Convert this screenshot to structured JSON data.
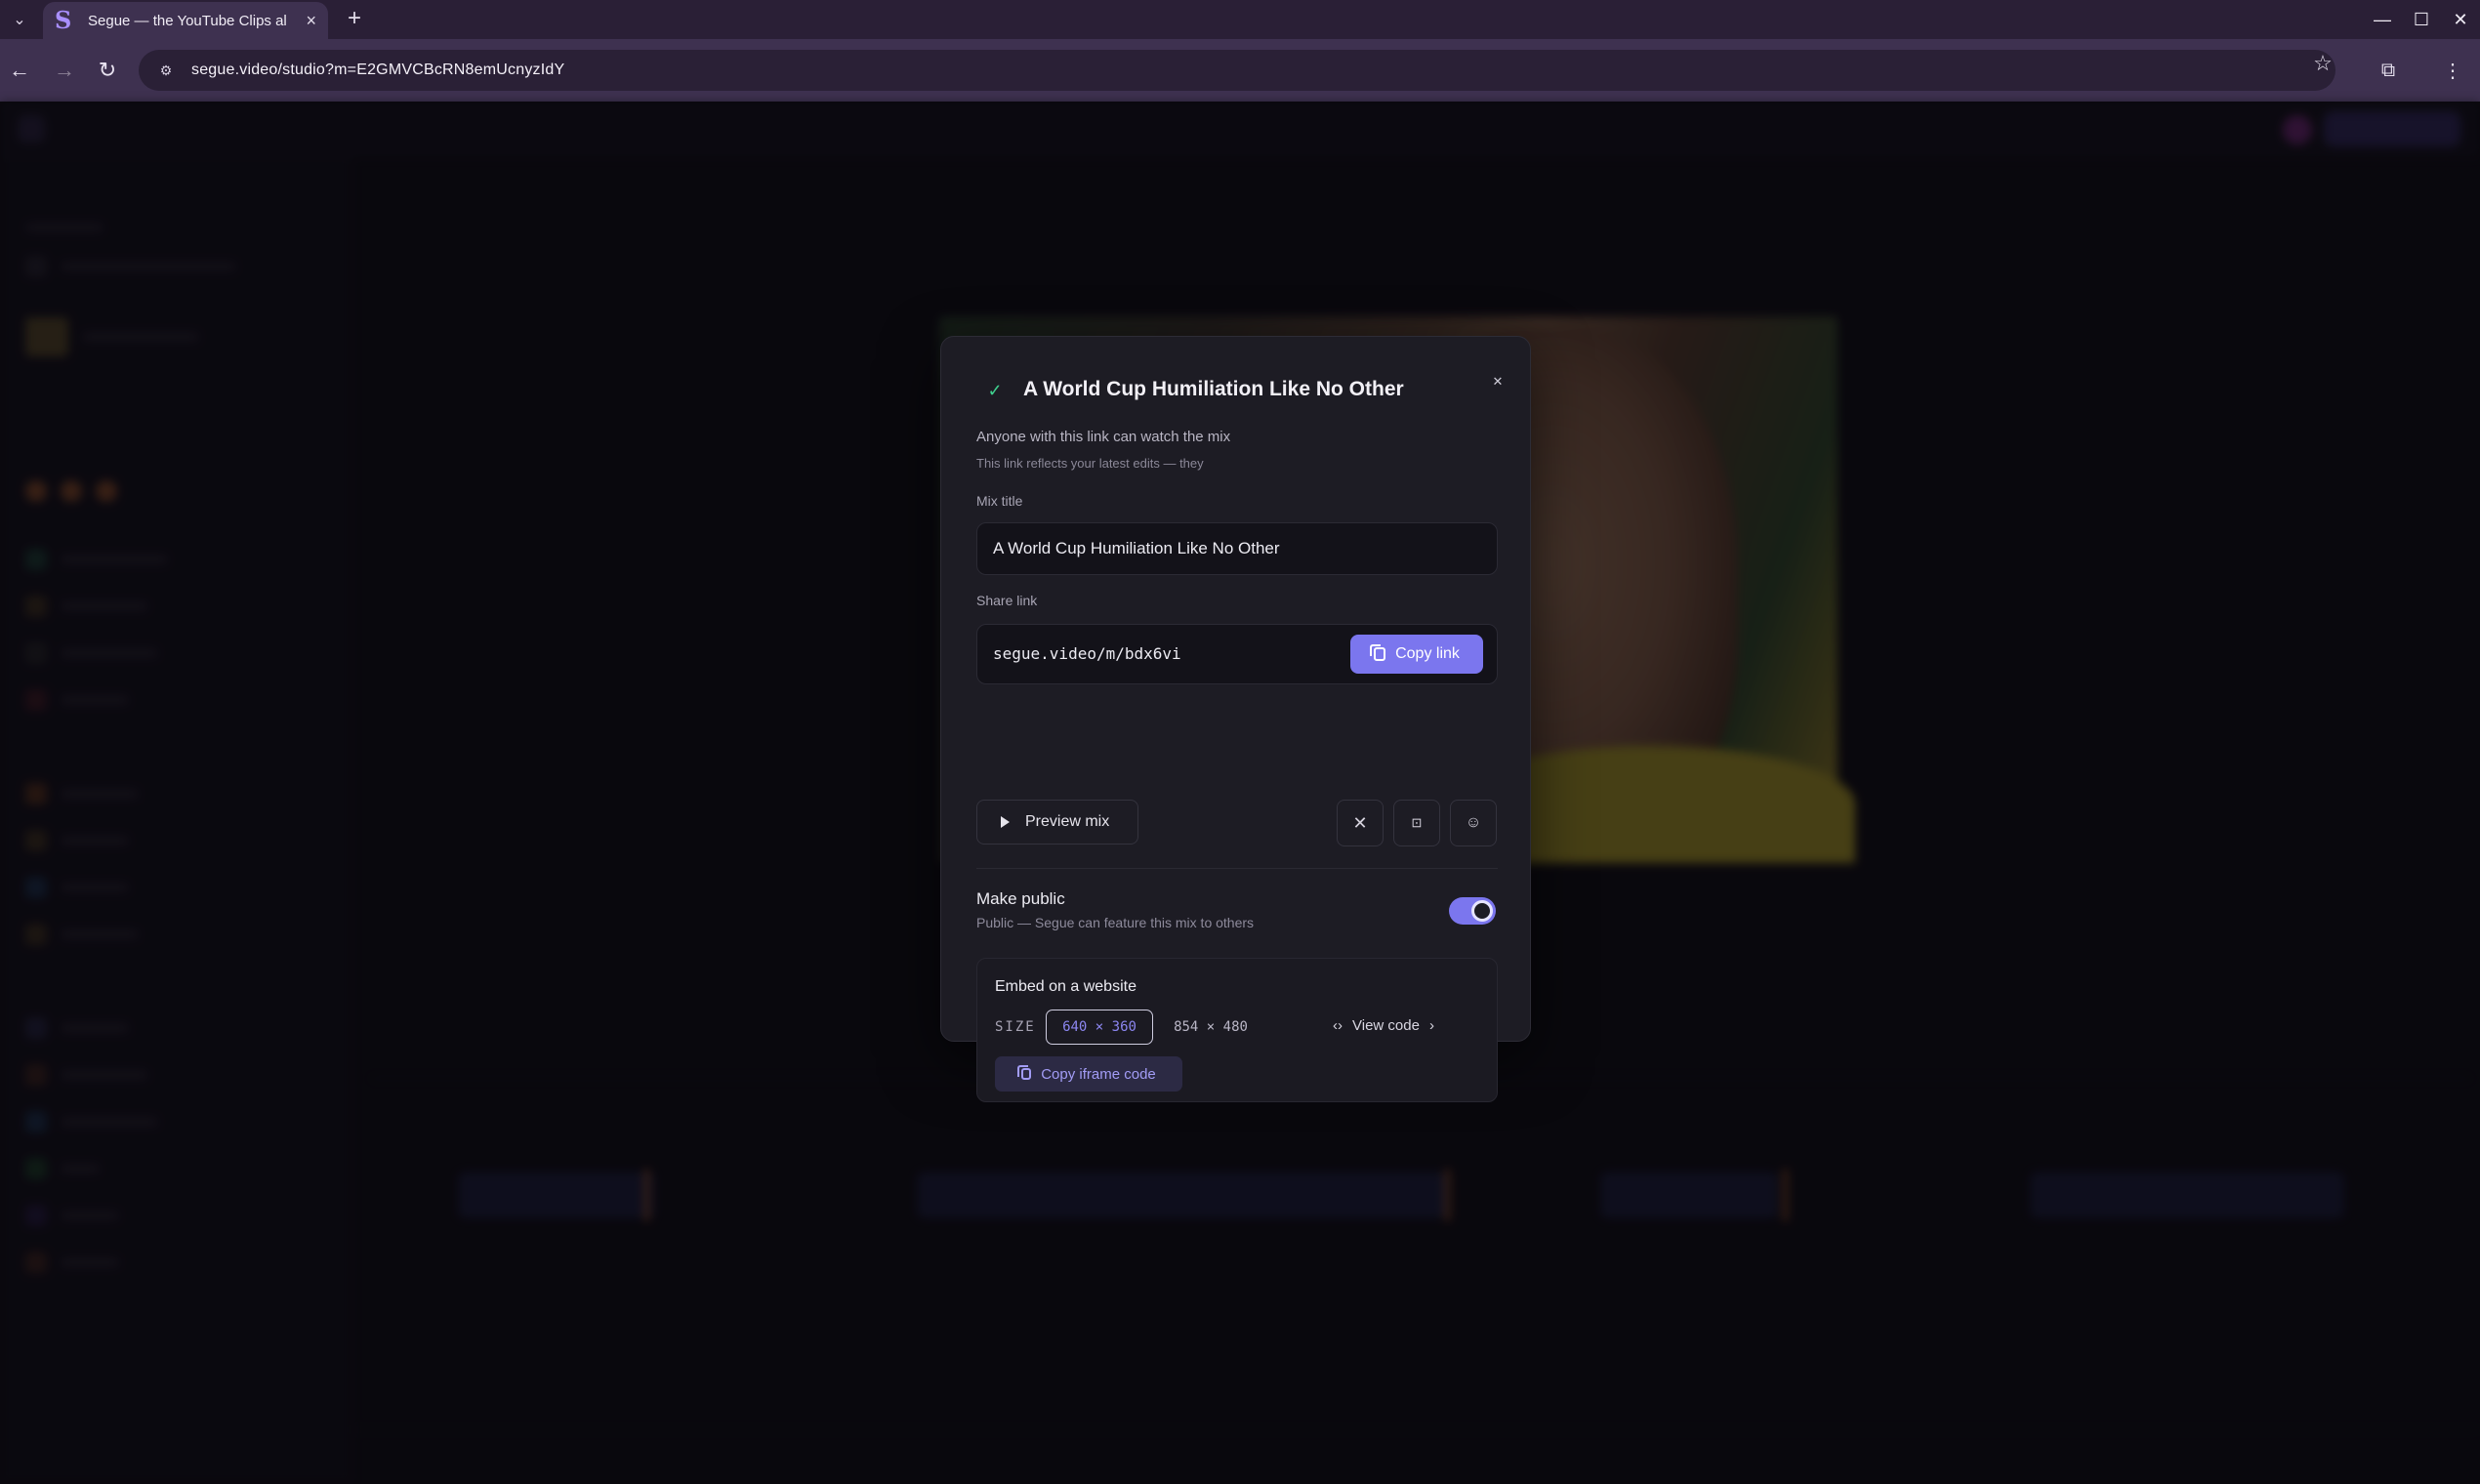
{
  "browser": {
    "tab_title": "Segue — the YouTube Clips al",
    "new_tab_label": "+",
    "url": "segue.video/studio?m=E2GMVCBcRN8emUcnyzIdY",
    "controls": {
      "minimize": "—",
      "maximize": "☐",
      "close": "✕"
    }
  },
  "modal": {
    "title": "A World Cup Humiliation Like No Other",
    "description": "Anyone with this link can watch the mix",
    "subtext": "This link reflects your latest edits — they",
    "mix_title_label": "Mix title",
    "mix_title_value": "A World Cup Humiliation Like No Other",
    "share_link_label": "Share link",
    "share_link_value": "segue.video/m/bdx6vi",
    "copy_link_label": "Copy link",
    "preview_label": "Preview mix",
    "share_icons": [
      "x-icon",
      "share-icon",
      "emoji-icon"
    ],
    "make_public_title": "Make public",
    "make_public_sub": "Public — Segue can feature this mix to others",
    "make_public_on": true,
    "embed": {
      "title": "Embed on a website",
      "size_label": "SIZE",
      "sizes": [
        "640 × 360",
        "854 × 480"
      ],
      "selected_size": "640 × 360",
      "view_code_label": "View code",
      "copy_iframe_label": "Copy iframe code"
    }
  },
  "colors": {
    "accent": "#7b76ee",
    "modal_bg": "#1d1c24",
    "success": "#3fcf8e",
    "browser_frame": "#3e3150"
  }
}
